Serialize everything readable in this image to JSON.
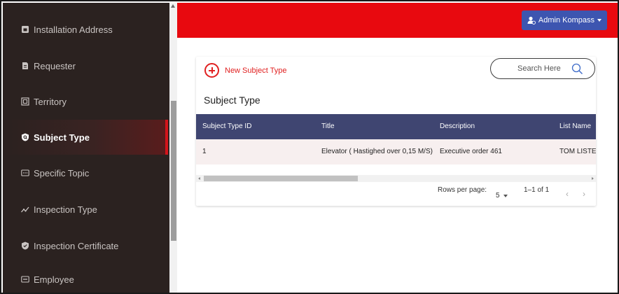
{
  "sidebar": {
    "items": [
      {
        "label": "Installation Address",
        "icon": "building-icon"
      },
      {
        "label": "Requester",
        "icon": "document-icon"
      },
      {
        "label": "Territory",
        "icon": "territory-icon"
      },
      {
        "label": "Subject Type",
        "icon": "shield-search-icon",
        "active": true
      },
      {
        "label": "Specific Topic",
        "icon": "topic-icon"
      },
      {
        "label": "Inspection Type",
        "icon": "trend-icon"
      },
      {
        "label": "Inspection Certificate",
        "icon": "certificate-shield-icon"
      },
      {
        "label": "Employee",
        "icon": "employee-card-icon"
      }
    ]
  },
  "header": {
    "user_label": "Admin Kompass",
    "user_icon": "user-gear-icon",
    "color": "#e8090f"
  },
  "toolbar": {
    "new_label": "New Subject Type",
    "search_placeholder": "Search Here"
  },
  "card": {
    "title": "Subject Type"
  },
  "table": {
    "columns": [
      "Subject Type ID",
      "Title",
      "Description",
      "List Name"
    ],
    "rows": [
      [
        "1",
        "Elevator ( Hastighed over 0,15 M/S)",
        "Executive order 461",
        "TOM LISTE"
      ]
    ]
  },
  "pagination": {
    "rows_per_page_label": "Rows per page:",
    "rows_per_page_value": "5",
    "range": "1–1 of 1",
    "prev": "‹",
    "next": "›"
  }
}
